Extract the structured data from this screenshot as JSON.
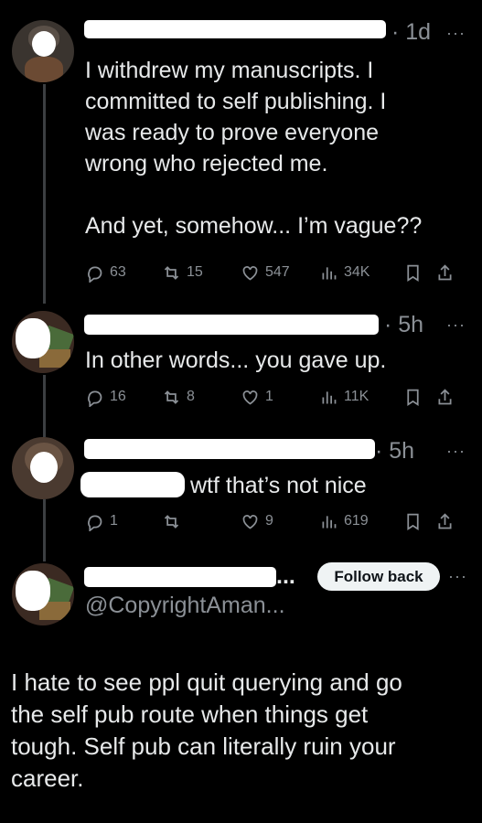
{
  "tweets": [
    {
      "time": "· 1d",
      "text_lines": [
        "I withdrew my manuscripts. I",
        "committed to self publishing. I",
        "was ready to prove everyone",
        "wrong who rejected me.",
        "",
        "And yet, somehow... I’m vague??"
      ],
      "replies": "63",
      "reposts": "15",
      "likes": "547",
      "views": "34K"
    },
    {
      "time": "· 5h",
      "text_lines": [
        "In other words... you gave up."
      ],
      "replies": "16",
      "reposts": "8",
      "likes": "1",
      "views": "11K"
    },
    {
      "time": "· 5h",
      "text_lines": [
        "wtf that’s not nice"
      ],
      "replies": "1",
      "reposts": "",
      "likes": "9",
      "views": "619"
    }
  ],
  "quote": {
    "follow_label": "Follow back",
    "handle": "@CopyrightAman...",
    "text_lines": [
      "I hate to see ppl quit querying and go",
      "the self pub route when things get",
      "tough.  Self pub can literally ruin your",
      "career."
    ]
  },
  "more_label": "···",
  "truncation": "...",
  "colors": {
    "background": "#000000",
    "text": "#e7e9ea",
    "muted": "#8b9096",
    "button": "#eff3f4"
  },
  "icons": [
    "reply-icon",
    "repost-icon",
    "like-icon",
    "views-icon",
    "bookmark-icon",
    "share-icon",
    "more-icon"
  ]
}
